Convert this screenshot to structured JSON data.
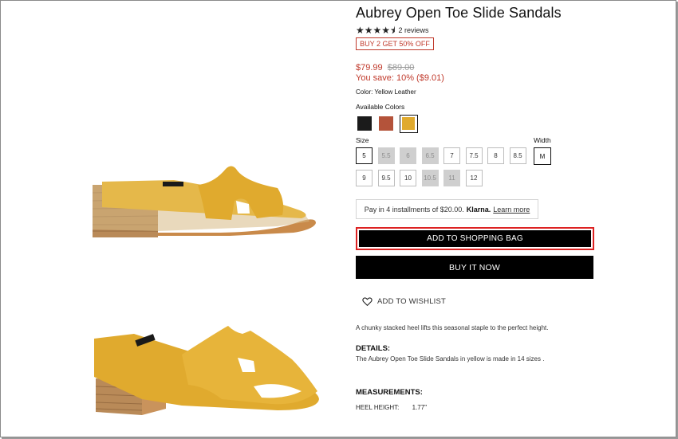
{
  "product": {
    "title": "Aubrey Open Toe Slide Sandals",
    "rating": {
      "stars": 4.5,
      "reviews_label": "2 reviews"
    },
    "promo": "BUY 2 GET 50% OFF",
    "price": "$79.99",
    "original_price": "$89.00",
    "savings": "You save: 10% ($9.01)",
    "color_label": "Color: Yellow Leather",
    "available_colors_label": "Available Colors",
    "colors": [
      {
        "name": "black",
        "hex": "#1b1b1b"
      },
      {
        "name": "cognac",
        "hex": "#b4533a"
      },
      {
        "name": "yellow",
        "hex": "#e0aa2e",
        "selected": true
      }
    ]
  },
  "size": {
    "label": "Size",
    "options": [
      {
        "v": "5",
        "state": "selected"
      },
      {
        "v": "5.5",
        "state": "unavailable"
      },
      {
        "v": "6",
        "state": "unavailable"
      },
      {
        "v": "6.5",
        "state": "unavailable"
      },
      {
        "v": "7",
        "state": "available"
      },
      {
        "v": "7.5",
        "state": "available"
      },
      {
        "v": "8",
        "state": "available"
      },
      {
        "v": "8.5",
        "state": "available"
      },
      {
        "v": "9",
        "state": "available"
      },
      {
        "v": "9.5",
        "state": "available"
      },
      {
        "v": "10",
        "state": "available"
      },
      {
        "v": "10.5",
        "state": "unavailable"
      },
      {
        "v": "11",
        "state": "unavailable"
      },
      {
        "v": "12",
        "state": "available"
      }
    ]
  },
  "width": {
    "label": "Width",
    "value": "M"
  },
  "klarna": {
    "text": "Pay in 4 installments of $20.00.",
    "brand": "Klarna.",
    "link": "Learn more"
  },
  "buttons": {
    "add_to_bag": "ADD TO SHOPPING BAG",
    "buy_now": "BUY IT NOW",
    "wishlist": "ADD TO WISHLIST"
  },
  "description": "A chunky stacked heel lifts this seasonal staple to the perfect height.",
  "details": {
    "heading": "DETAILS:",
    "text": "The Aubrey Open Toe Slide Sandals in yellow is made in 14 sizes ."
  },
  "measurements": {
    "heading": "MEASUREMENTS:",
    "heel_label": "HEEL HEIGHT:",
    "heel_value": "1.77\""
  },
  "colors": {
    "accent_red": "#c0392b",
    "button_black": "#000000",
    "shoe_yellow": "#e0aa2e"
  }
}
